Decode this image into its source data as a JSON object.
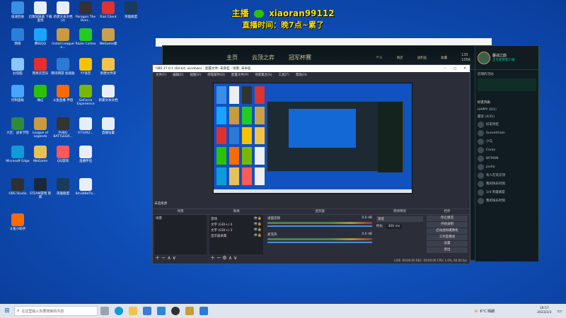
{
  "overlay": {
    "line1_prefix": "主播",
    "line1_handle": "xiaoran99112",
    "line2": "直播时间：晚7点~累了"
  },
  "desktop_icons": [
    {
      "label": "极速回收",
      "color": "#3a8ee6"
    },
    {
      "label": "迅雷加速器 下载查找",
      "color": "#e8eef8"
    },
    {
      "label": "新建文本文档 (2)",
      "color": "#e8eef8"
    },
    {
      "label": "Paragon The Over...",
      "color": "#333"
    },
    {
      "label": "Riot Client",
      "color": "#d33"
    },
    {
      "label": "网络",
      "color": "#2b7fd8"
    },
    {
      "label": "腾讯QQ",
      "color": "#1aa3ff"
    },
    {
      "label": "Install League o...",
      "color": "#c89b3c"
    },
    {
      "label": "Razer Cortex",
      "color": "#2c2"
    },
    {
      "label": "WeGame版",
      "color": "#caa04b"
    },
    {
      "label": "英雄联盟",
      "color": "#1a3b5a"
    },
    {
      "label": "此电脑",
      "color": "#8bc5ff"
    },
    {
      "label": "网易云音乐",
      "color": "#e3302f"
    },
    {
      "label": "腾讯网游 加速器",
      "color": "#2c7ad6"
    },
    {
      "label": "YY语音",
      "color": "#f5c400"
    },
    {
      "label": "新建文件夹",
      "color": "#f3c24a"
    },
    {
      "label": "控制面板",
      "color": "#4aa3ff"
    },
    {
      "label": "微信",
      "color": "#2ec100"
    },
    {
      "label": "斗鱼直播 伴侣",
      "color": "#ff6a00"
    },
    {
      "label": "GeForce Experience",
      "color": "#76b900"
    },
    {
      "label": "新建文本文档",
      "color": "#e8eef8"
    },
    {
      "label": "大区：战争学院",
      "color": "#2f8a3b"
    },
    {
      "label": "League of Legends",
      "color": "#c89b3c"
    },
    {
      "label": "PUBG BATTLEGR...",
      "color": "#333"
    },
    {
      "label": "071492…",
      "color": "#e8eef8"
    },
    {
      "label": "Microsoft Edge",
      "color": "#0f9bd7"
    },
    {
      "label": "WeGame",
      "color": "#e8c05a"
    },
    {
      "label": "QQ游戏",
      "color": "#ff5a5a"
    },
    {
      "label": "直播伴侣",
      "color": "#e8eef8"
    },
    {
      "label": "直播设置",
      "color": "#e8eef8"
    },
    {
      "label": "OBS Studio",
      "color": "#303030"
    },
    {
      "label": "STEAM游戏 管家",
      "color": "#1b2838"
    },
    {
      "label": "英雄联盟",
      "color": "#1a3b5a"
    },
    {
      "label": "8m348eTb...",
      "color": "#e8eef8"
    },
    {
      "label": "斗鱼小助手",
      "color": "#ff6a00"
    }
  ],
  "lol": {
    "tabs": [
      "主页",
      "云顶之弈",
      "冠军杯赛"
    ],
    "nav": [
      "个人",
      "商店",
      "战利品",
      "收藏"
    ],
    "currency": {
      "rp": "135",
      "be": "105K"
    },
    "profile_name": "鏖战之韵",
    "status": "正在使用客户端",
    "friends_header": "好友列表",
    "groups": [
      "HAPPY (0/1)",
      "最近 (4/31)"
    ],
    "friends": [
      "好友待定",
      "Sunsetmain",
      "小马",
      "Corey",
      "BITMAN",
      "jouha",
      "有人在玩云顶",
      "我的快乐时刻",
      "1/4 英雄联盟",
      "我的快乐时刻"
    ],
    "chat_status": "在线",
    "recent_label": "近期的活动"
  },
  "obs": {
    "title": "OBS 27.0.1 (64-bit, windows) - 配置文件: 未命名 - 场景: 未命名",
    "menu": [
      "文件(F)",
      "编辑(E)",
      "视图(V)",
      "停靠部件(D)",
      "配置文件(P)",
      "场景集合(S)",
      "工具(T)",
      "帮助(H)"
    ],
    "status_bar_label": "未选择源",
    "docks": {
      "scenes": "场景",
      "sources": "来源",
      "mixer": "混音器",
      "transitions": "转场特效",
      "controls": "控件"
    },
    "scenes": [
      "场景"
    ],
    "sources": [
      "游戏",
      "文字 (GDI+) 4",
      "文字 (GDI+) 3",
      "显示器采集"
    ],
    "mixer_channels": [
      "桌面音频",
      "麦克风"
    ],
    "mixer_db": [
      "0.0 dB",
      "0.0 dB"
    ],
    "transition_type": "渐变",
    "transition_duration_label": "时长",
    "transition_duration": "300 ms",
    "controls": [
      "停止推流",
      "开始录制",
      "启动虚拟摄像机",
      "工作室模式",
      "设置",
      "退出"
    ],
    "status_line": "LIVE: 00:00:00  REC: 00:00:00  CPU: 1.0%, 60.00 fps"
  },
  "taskbar": {
    "search_placeholder": "在这里输入你要搜索的内容",
    "weather": "6°C 晴朗",
    "time": "18:57",
    "date": "2023/2/3"
  }
}
